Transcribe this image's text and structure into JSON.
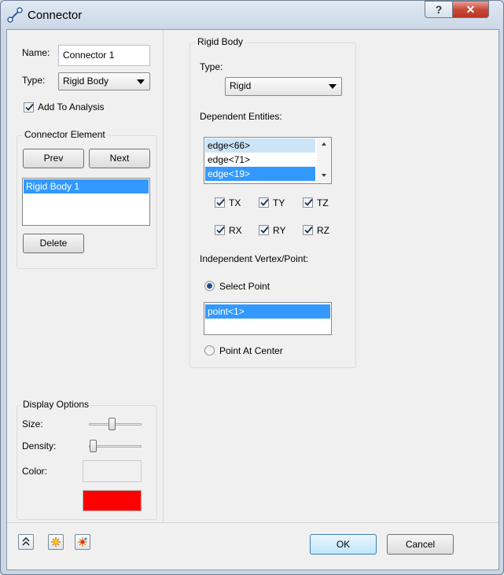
{
  "window": {
    "title": "Connector"
  },
  "left": {
    "name_label": "Name:",
    "name_value": "Connector 1",
    "type_label": "Type:",
    "type_value": "Rigid Body",
    "add_to_analysis": {
      "label": "Add To Analysis",
      "checked": true
    },
    "connector_element": {
      "title": "Connector Element",
      "prev": "Prev",
      "next": "Next",
      "items": [
        "Rigid Body 1"
      ],
      "selected_index": 0,
      "delete": "Delete"
    },
    "display_options": {
      "title": "Display Options",
      "size_label": "Size:",
      "density_label": "Density:",
      "color_label": "Color:",
      "color_swatch": "#ff0000"
    }
  },
  "rigid_body": {
    "title": "Rigid Body",
    "type_label": "Type:",
    "type_value": "Rigid",
    "dependent_label": "Dependent Entities:",
    "dependent_items": [
      "edge<66>",
      "edge<71>",
      "edge<19>"
    ],
    "dof": [
      {
        "label": "TX",
        "checked": true
      },
      {
        "label": "TY",
        "checked": true
      },
      {
        "label": "TZ",
        "checked": true
      },
      {
        "label": "RX",
        "checked": true
      },
      {
        "label": "RY",
        "checked": true
      },
      {
        "label": "RZ",
        "checked": true
      }
    ],
    "independent_label": "Independent Vertex/Point:",
    "select_point_label": "Select Point",
    "point_items": [
      "point<1>"
    ],
    "point_at_center_label": "Point At Center"
  },
  "footer": {
    "ok": "OK",
    "cancel": "Cancel"
  },
  "colors": {
    "selection": "#3399ff",
    "selection_light": "#cce4f7",
    "swatch": "#ff0000"
  }
}
